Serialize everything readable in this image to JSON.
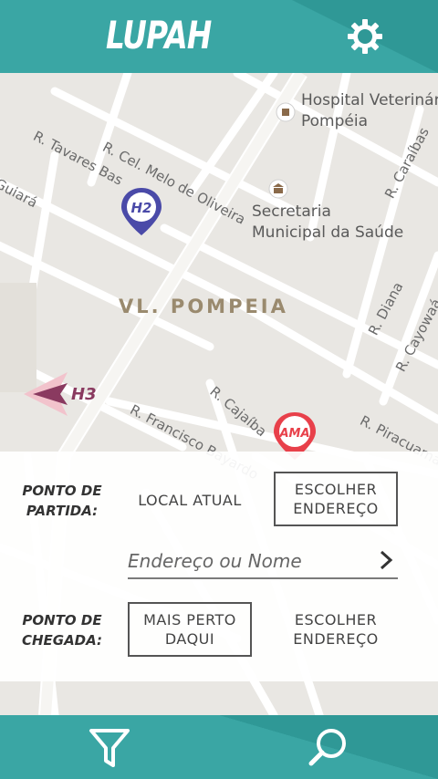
{
  "header": {
    "title": "LUPAH",
    "settings_icon": "gear-icon"
  },
  "map": {
    "district": "VL. POMPEIA",
    "places": {
      "hospital_line1": "Hospital Veterinári",
      "hospital_line2": "Pompéia",
      "secretaria_line1": "Secretaria",
      "secretaria_line2": "Municipal da Saúde"
    },
    "streets": {
      "cel_melo": "R. Cel. Melo de Oliveira",
      "tavares": "R. Tavares Bas",
      "guiara": "Guiará",
      "caraibas": "R. Caraíbas",
      "diana": "R. Diana",
      "cayowaa": "R. Cayowaá",
      "francisco_bayardo": "R. Francisco Bayardo",
      "cajaiba": "R. Cajaíba",
      "piracuama": "R. Piracuama"
    },
    "markers": {
      "h2": "H2",
      "h3": "H3",
      "ama": "AMA"
    }
  },
  "panel": {
    "departure_label_1": "PONTO DE",
    "departure_label_2": "PARTIDA:",
    "current_location": "LOCAL ATUAL",
    "choose_address_1": "ESCOLHER",
    "choose_address_2": "ENDEREÇO",
    "search_placeholder": "Endereço ou Nome",
    "arrival_label_1": "PONTO DE",
    "arrival_label_2": "CHEGADA:",
    "nearest_1": "MAIS PERTO",
    "nearest_2": "DAQUI",
    "choose_address_b_1": "ESCOLHER",
    "choose_address_b_2": "ENDEREÇO"
  },
  "colors": {
    "primary": "#3aa6a4",
    "primary_dark": "#2f9896",
    "h2_marker": "#4a4aa8",
    "h3_marker": "#8a3a60",
    "ama_marker": "#e8404a"
  },
  "bottom_bar": {
    "filter_icon": "filter-icon",
    "search_icon": "search-icon"
  }
}
